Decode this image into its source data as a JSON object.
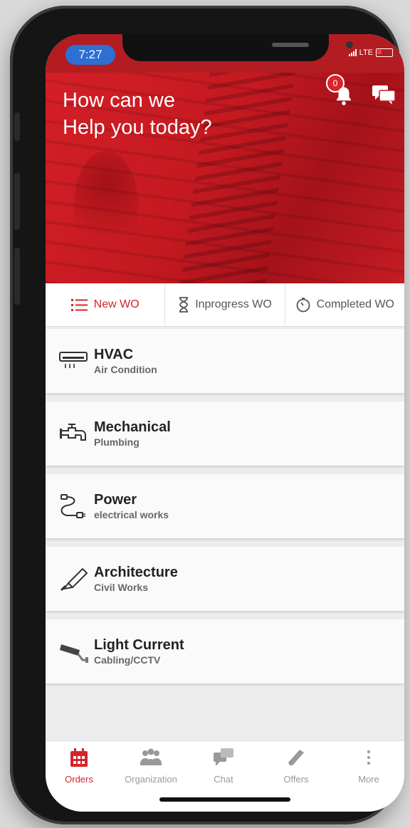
{
  "status_bar": {
    "time": "7:27",
    "network": "LTE"
  },
  "header": {
    "title_line1": "How can we",
    "title_line2": "Help you today?",
    "notification_count": "0"
  },
  "tabs": [
    {
      "label": "New WO",
      "icon": "list-icon",
      "active": true
    },
    {
      "label": "Inprogress WO",
      "icon": "hourglass-icon",
      "active": false
    },
    {
      "label": "Completed WO",
      "icon": "timer-icon",
      "active": false
    }
  ],
  "categories": [
    {
      "title": "HVAC",
      "subtitle": "Air Condition",
      "icon": "air-conditioner-icon"
    },
    {
      "title": "Mechanical",
      "subtitle": "Plumbing",
      "icon": "faucet-icon"
    },
    {
      "title": "Power",
      "subtitle": "electrical works",
      "icon": "plug-cable-icon"
    },
    {
      "title": "Architecture",
      "subtitle": "Civil Works",
      "icon": "trowel-icon"
    },
    {
      "title": "Light Current",
      "subtitle": "Cabling/CCTV",
      "icon": "cctv-camera-icon"
    }
  ],
  "tabbar": [
    {
      "label": "Orders",
      "icon": "calendar-icon",
      "active": true
    },
    {
      "label": "Organization",
      "icon": "people-icon",
      "active": false
    },
    {
      "label": "Chat",
      "icon": "chat-bubbles-icon",
      "active": false
    },
    {
      "label": "Offers",
      "icon": "tag-icon",
      "active": false
    },
    {
      "label": "More",
      "icon": "more-vertical-icon",
      "active": false
    }
  ],
  "colors": {
    "brand_red": "#d4242a",
    "status_blue": "#2d6fd2"
  }
}
